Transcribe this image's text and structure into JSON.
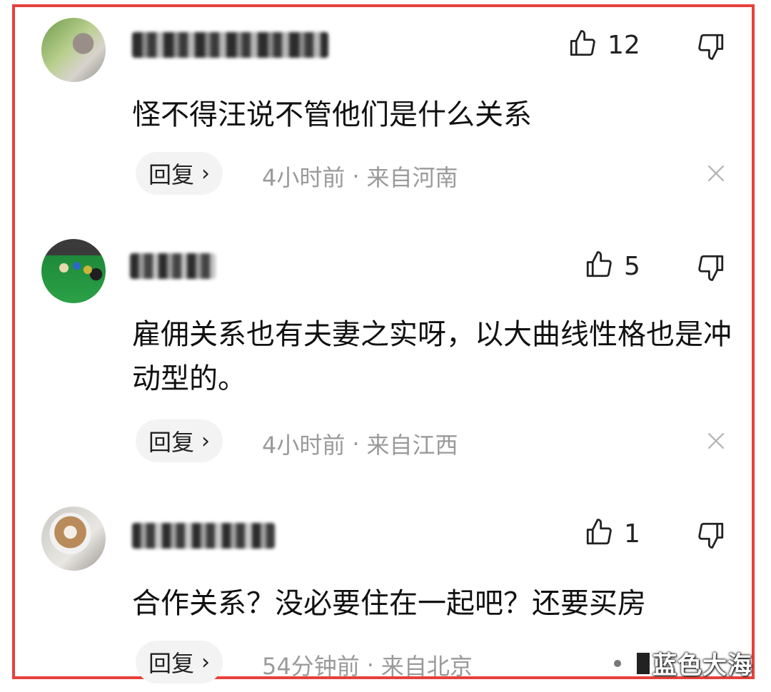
{
  "comments": [
    {
      "likes": "12",
      "text": "怪不得汪说不管他们是什么关系",
      "reply_label": "回复",
      "time": "4小时前",
      "location": "来自河南"
    },
    {
      "likes": "5",
      "text": "雇佣关系也有夫妻之实呀，以大曲线性格也是冲动型的。",
      "reply_label": "回复",
      "time": "4小时前",
      "location": "来自江西"
    },
    {
      "likes": "1",
      "text": "合作关系？没必要住在一起吧？还要买房",
      "reply_label": "回复",
      "time": "54分钟前",
      "location": "来自北京"
    }
  ],
  "meta_separator": "·",
  "reply_chevron": "›",
  "watermark": "蓝色大海",
  "icons": {
    "like": "thumbs-up-icon",
    "dislike": "thumbs-down-icon",
    "close": "close-icon",
    "chevron": "chevron-right-icon"
  },
  "colors": {
    "frame": "#e8403c",
    "meta_text": "#9a9a9a",
    "reply_bg": "#f3f3f3"
  }
}
